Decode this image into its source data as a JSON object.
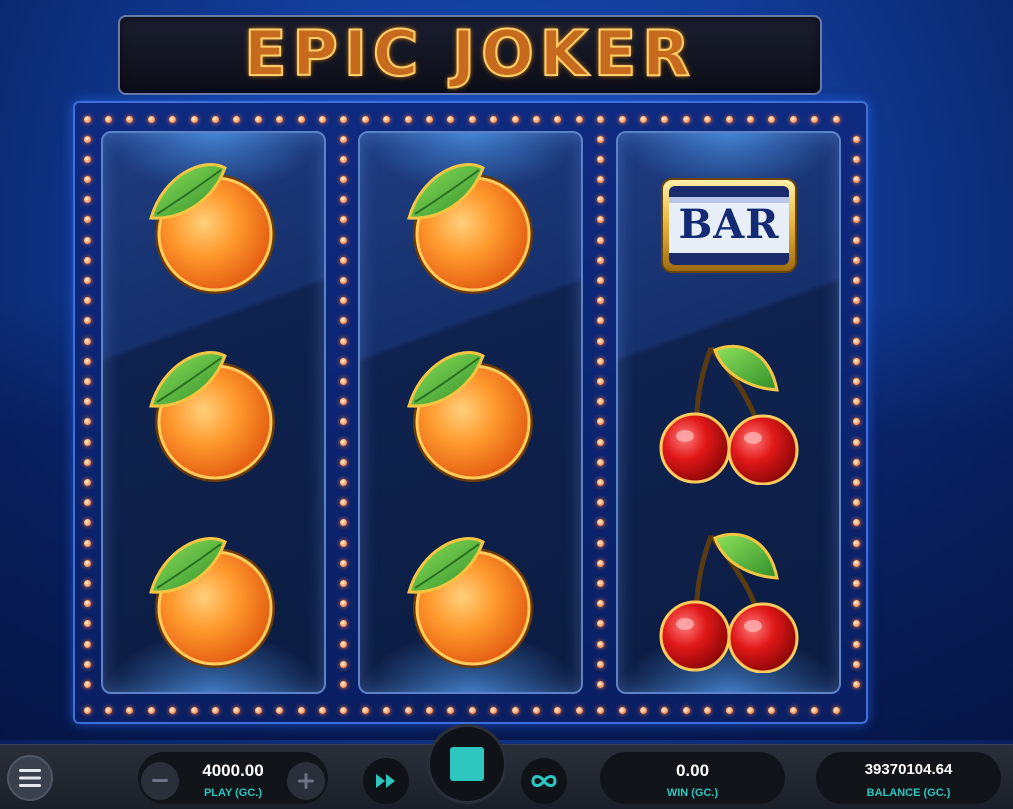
{
  "game": {
    "title": "EPIC JOKER"
  },
  "reels": [
    {
      "symbols": [
        "orange-symbol",
        "orange-symbol",
        "orange-symbol"
      ]
    },
    {
      "symbols": [
        "orange-symbol",
        "orange-symbol",
        "orange-symbol"
      ]
    },
    {
      "symbols": [
        "bar-symbol",
        "cherry-symbol",
        "cherry-symbol"
      ]
    }
  ],
  "bar_symbol_text": "BAR",
  "controls": {
    "menu_icon": "hamburger-menu-icon",
    "play_value": "4000.00",
    "play_label": "PLAY (GC.)",
    "minus_icon": "minus-icon",
    "plus_icon": "plus-icon",
    "turbo_icon": "fast-forward-icon",
    "spin_icon": "stop-square-icon",
    "autoplay_icon": "infinity-icon",
    "win_value": "0.00",
    "win_label": "WIN (GC.)",
    "balance_value": "39370104.64",
    "balance_label": "BALANCE (GC.)"
  },
  "colors": {
    "accent": "#2ec7c0",
    "bulb": "#ff7a3a",
    "frame": "#3f6fd8"
  }
}
